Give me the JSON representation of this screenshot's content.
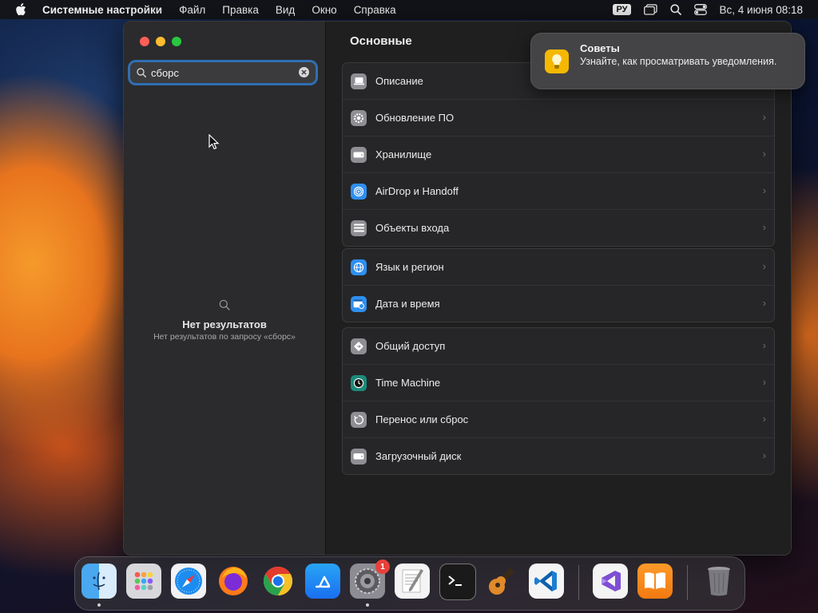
{
  "menubar": {
    "app_name": "Системные настройки",
    "menus": [
      "Файл",
      "Правка",
      "Вид",
      "Окно",
      "Справка"
    ],
    "input_source": "РУ",
    "clock": "Вс, 4 июня  08:18"
  },
  "sidebar": {
    "search_value": "сборс",
    "no_results_title": "Нет результатов",
    "no_results_subtitle": "Нет результатов по запросу «сборс»"
  },
  "content": {
    "title": "Основные",
    "groups": [
      [
        {
          "label": "Описание",
          "icon": "laptop-icon",
          "color": "#8e8e93"
        },
        {
          "label": "Обновление ПО",
          "icon": "gear-badge-icon",
          "color": "#8e8e93"
        },
        {
          "label": "Хранилище",
          "icon": "drive-icon",
          "color": "#8e8e93"
        },
        {
          "label": "AirDrop и Handoff",
          "icon": "airdrop-icon",
          "color": "#2f8ff0"
        },
        {
          "label": "Объекты входа",
          "icon": "list-icon",
          "color": "#8e8e93"
        }
      ],
      [
        {
          "label": "Язык и регион",
          "icon": "globe-icon",
          "color": "#2f8ff0"
        },
        {
          "label": "Дата и время",
          "icon": "calendar-clock-icon",
          "color": "#2f8ff0"
        }
      ],
      [
        {
          "label": "Общий доступ",
          "icon": "sharing-icon",
          "color": "#8e8e93"
        },
        {
          "label": "Time Machine",
          "icon": "time-machine-icon",
          "color": "#1b8a7a"
        },
        {
          "label": "Перенос или сброс",
          "icon": "reset-icon",
          "color": "#8e8e93"
        },
        {
          "label": "Загрузочный диск",
          "icon": "disk-icon",
          "color": "#8e8e93"
        }
      ]
    ]
  },
  "notification": {
    "title": "Советы",
    "body": "Узнайте, как просматривать уведомления."
  },
  "dock": {
    "badge_count": "1",
    "items": [
      "finder-icon",
      "launchpad-icon",
      "safari-icon",
      "firefox-icon",
      "chrome-icon",
      "app-store-icon",
      "system-settings-icon",
      "textedit-icon",
      "terminal-icon",
      "garageband-icon",
      "vscode-icon",
      "visual-studio-icon",
      "books-icon",
      "trash-icon"
    ]
  }
}
